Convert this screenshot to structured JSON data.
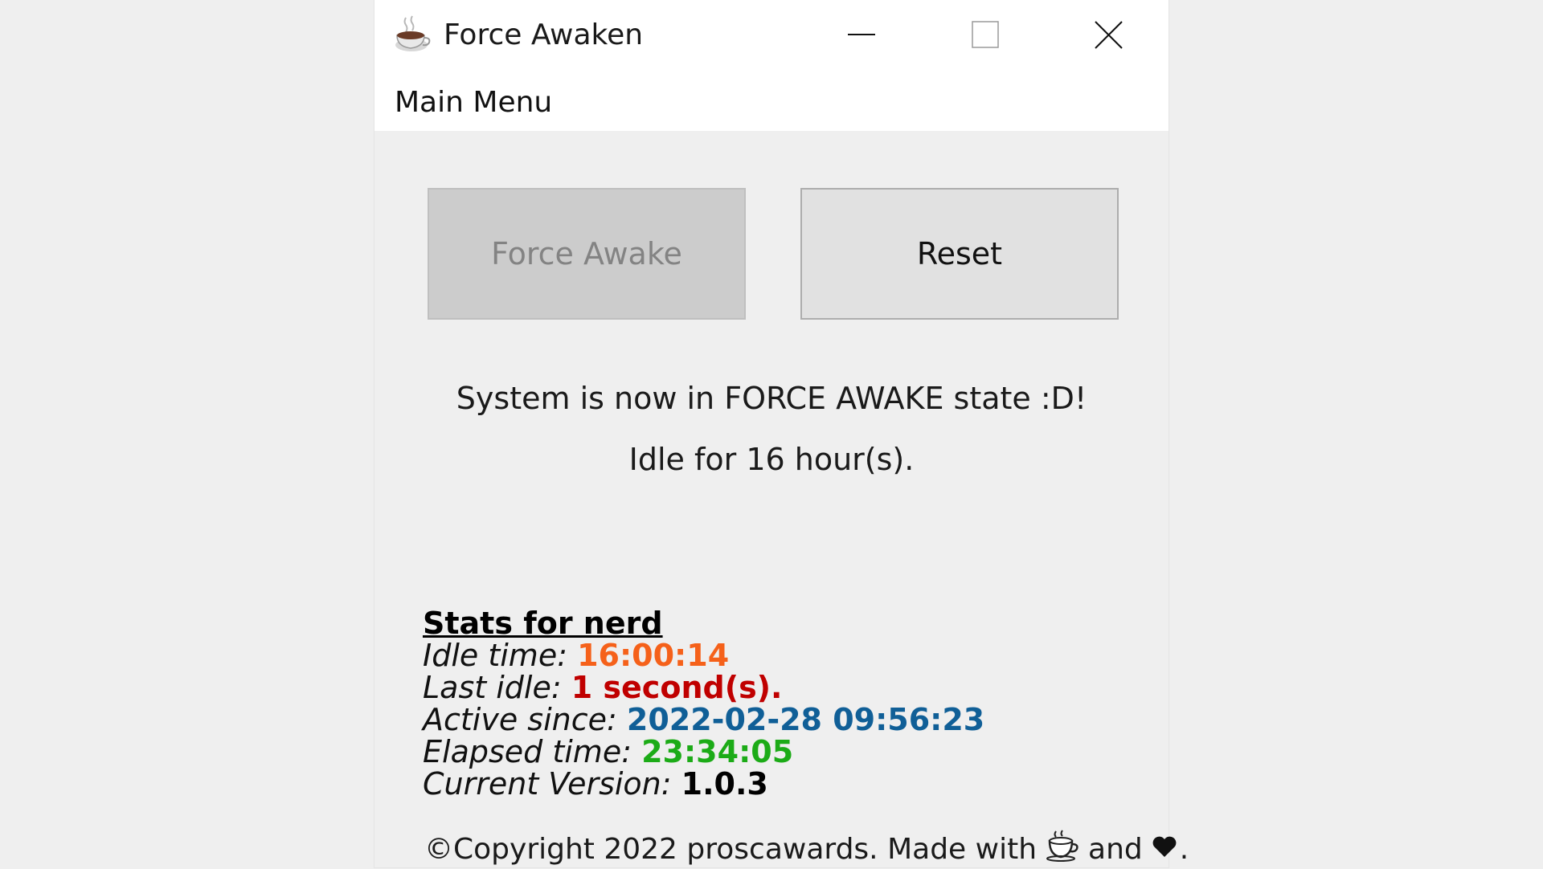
{
  "window": {
    "title": "Force Awaken",
    "app_icon": "coffee-cup-icon",
    "controls": {
      "minimize": "minimize-icon",
      "maximize": "maximize-icon",
      "close": "close-icon"
    }
  },
  "menu": {
    "items": [
      {
        "label": "Main Menu"
      }
    ]
  },
  "buttons": {
    "force_awake": {
      "label": "Force Awake",
      "enabled": false
    },
    "reset": {
      "label": "Reset",
      "enabled": true
    }
  },
  "status": {
    "state_message": "System is now in FORCE AWAKE state :D!",
    "idle_message": "Idle for 16 hour(s)."
  },
  "stats": {
    "title": "Stats for nerd",
    "rows": [
      {
        "label": "Idle time:",
        "value": "16:00:14",
        "color": "#f5611a"
      },
      {
        "label": "Last idle:",
        "value": "1 second(s).",
        "color": "#c00000"
      },
      {
        "label": "Active since:",
        "value": "2022-02-28 09:56:23",
        "color": "#105f97"
      },
      {
        "label": "Elapsed time:",
        "value": "23:34:05",
        "color": "#1cab17"
      },
      {
        "label": "Current Version:",
        "value": "1.0.3",
        "color": "#000000"
      }
    ]
  },
  "footer": {
    "text_before": "©Copyright 2022 proscawards. Made with",
    "icon_1": "coffee-cup-icon",
    "text_middle": "and",
    "icon_2": "heart-icon",
    "text_after": "."
  },
  "colors": {
    "titlebar_bg": "#ffffff",
    "window_bg": "#efefef",
    "disabled_button_bg": "#cccccc",
    "button_bg": "#e1e1e1"
  }
}
